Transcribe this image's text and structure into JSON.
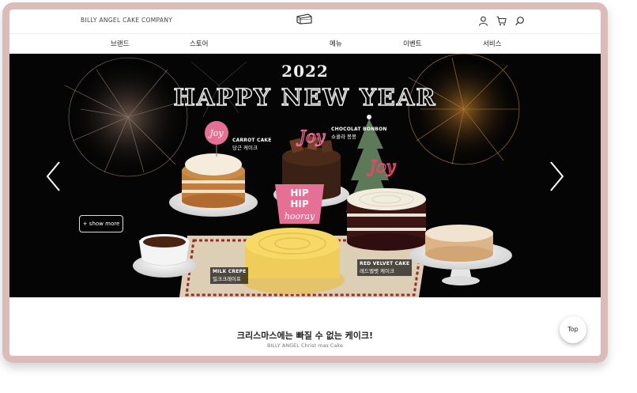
{
  "header": {
    "brand": "BILLY ANGEL CAKE COMPANY",
    "icons": [
      "user-icon",
      "cart-icon",
      "search-icon"
    ]
  },
  "nav": {
    "items": [
      "브랜드",
      "스토어",
      "메뉴",
      "이벤트",
      "서비스"
    ]
  },
  "hero": {
    "year": "2022",
    "headline": "HAPPY NEW YEAR",
    "show_more": "+ show more",
    "labels": {
      "carrot": {
        "en": "CARROT CAKE",
        "ko": "당근 케이크"
      },
      "chocolat": {
        "en": "CHOCOLAT BONBON",
        "ko": "쇼콜라 봉봉"
      },
      "milk": {
        "en": "MILK CREPE",
        "ko": "밀크크레이프"
      },
      "redvelvet": {
        "en": "RED VELVET CAKE",
        "ko": "레드벨벳 케이크"
      }
    },
    "toppers": {
      "joy1": "Joy",
      "joy2": "Joy",
      "hip1": "HIP",
      "hip2": "HIP",
      "hooray": "hooray"
    }
  },
  "caption": {
    "title": "크리스마스에는 빠질 수 없는 케이크!",
    "subtitle": "BILLY ANGEL Christ mas Cake"
  },
  "top_button": "Top",
  "colors": {
    "frame": "#dcbcb9",
    "hero_bg": "#050505",
    "pink": "#e66f95"
  }
}
